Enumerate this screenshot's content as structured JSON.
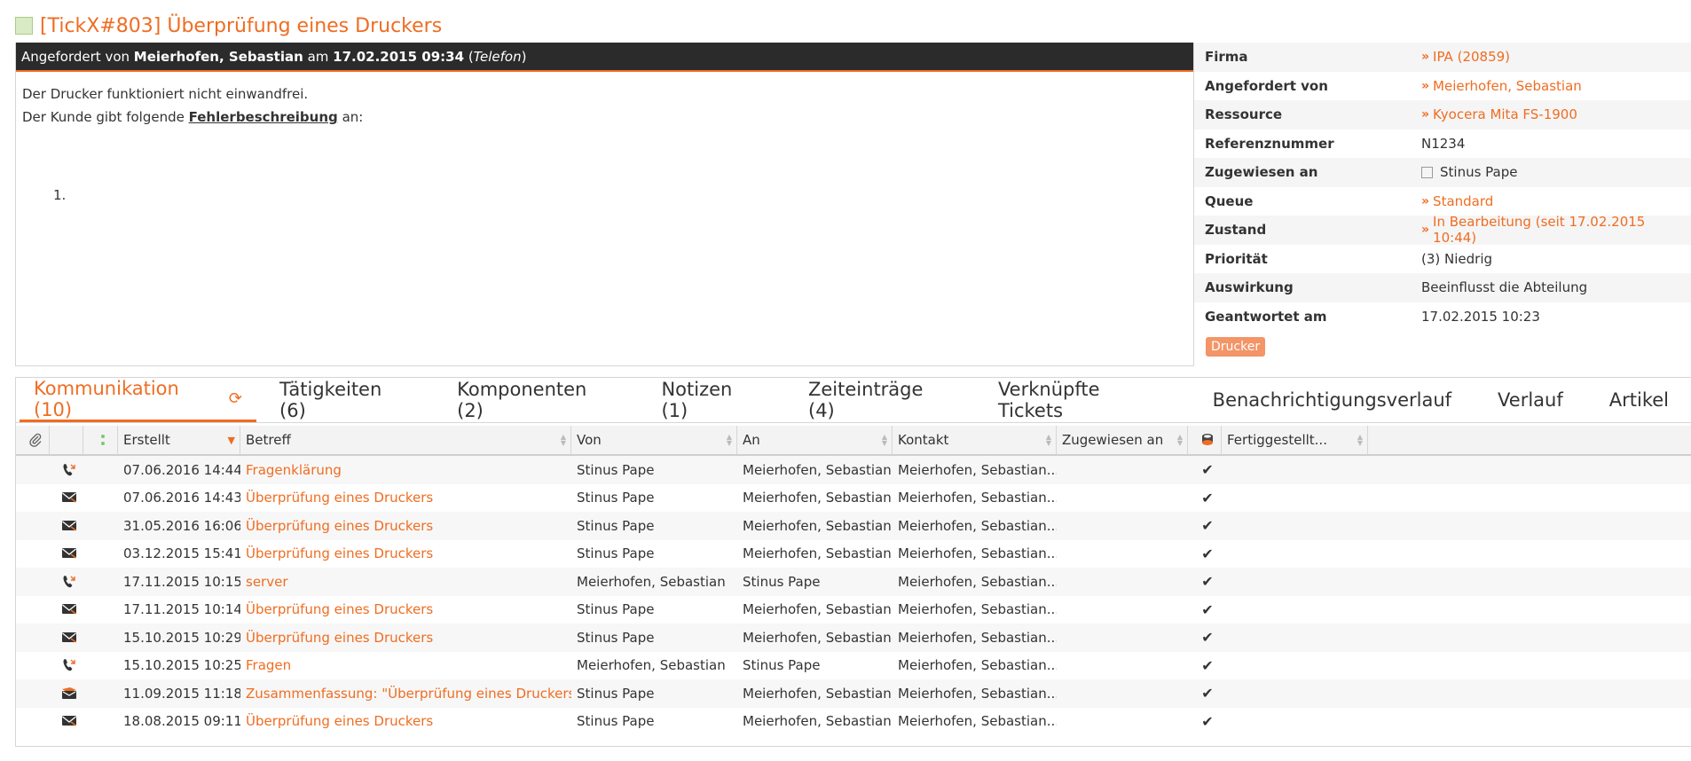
{
  "title": "[TickX#803] Überprüfung eines Druckers",
  "request": {
    "prefix": "Angefordert von",
    "requester": "Meierhofen, Sebastian",
    "at": "am",
    "datetime": "17.02.2015 09:34",
    "channel_open": "(",
    "channel": "Telefon",
    "channel_close": ")"
  },
  "description": {
    "line1": "Der Drucker funktioniert nicht einwandfrei.",
    "line2_prefix": "Der Kunde gibt folgende",
    "line2_link": "Fehlerbeschreibung",
    "line2_suffix": "an:",
    "list_item": "1."
  },
  "properties": [
    {
      "label": "Firma",
      "value": "IPA (20859)",
      "type": "link"
    },
    {
      "label": "Angefordert von",
      "value": "Meierhofen, Sebastian",
      "type": "link"
    },
    {
      "label": "Ressource",
      "value": "Kyocera Mita FS-1900",
      "type": "link"
    },
    {
      "label": "Referenznummer",
      "value": "N1234",
      "type": "text"
    },
    {
      "label": "Zugewiesen an",
      "value": "Stinus Pape",
      "type": "checkbox"
    },
    {
      "label": "Queue",
      "value": "Standard",
      "type": "link"
    },
    {
      "label": "Zustand",
      "value": "In Bearbeitung (seit 17.02.2015 10:44)",
      "type": "link"
    },
    {
      "label": "Priorität",
      "value": "(3) Niedrig",
      "type": "text"
    },
    {
      "label": "Auswirkung",
      "value": "Beeinflusst die Abteilung",
      "type": "text"
    },
    {
      "label": "Geantwortet am",
      "value": "17.02.2015 10:23",
      "type": "text"
    }
  ],
  "tag": "Drucker",
  "tabs": [
    {
      "label": "Kommunikation (10)",
      "active": true
    },
    {
      "label": "Tätigkeiten (6)"
    },
    {
      "label": "Komponenten (2)"
    },
    {
      "label": "Notizen (1)"
    },
    {
      "label": "Zeiteinträge (4)"
    },
    {
      "label": "Verknüpfte Tickets"
    },
    {
      "label": "Benachrichtigungsverlauf"
    },
    {
      "label": "Verlauf"
    },
    {
      "label": "Artikel"
    }
  ],
  "columns": {
    "created": "Erstellt",
    "subject": "Betreff",
    "from": "Von",
    "to": "An",
    "contact": "Kontakt",
    "assigned": "Zugewiesen an",
    "done": "Fertiggestellt..."
  },
  "rows": [
    {
      "type": "phone",
      "created": "07.06.2016 14:44",
      "subject": "Fragenklärung",
      "from": "Stinus Pape",
      "to": "Meierhofen, Sebastian",
      "contact": "Meierhofen, Sebastian...",
      "assigned": "",
      "done": "✔"
    },
    {
      "type": "mail",
      "created": "07.06.2016 14:43",
      "subject": "Überprüfung eines Druckers",
      "from": "Stinus Pape",
      "to": "Meierhofen, Sebastian",
      "contact": "Meierhofen, Sebastian...",
      "assigned": "",
      "done": "✔"
    },
    {
      "type": "mail",
      "created": "31.05.2016 16:06",
      "subject": "Überprüfung eines Druckers",
      "from": "Stinus Pape",
      "to": "Meierhofen, Sebastian",
      "contact": "Meierhofen, Sebastian...",
      "assigned": "",
      "done": "✔"
    },
    {
      "type": "mail",
      "created": "03.12.2015 15:41",
      "subject": "Überprüfung eines Druckers",
      "from": "Stinus Pape",
      "to": "Meierhofen, Sebastian",
      "contact": "Meierhofen, Sebastian...",
      "assigned": "",
      "done": "✔"
    },
    {
      "type": "phone-in",
      "created": "17.11.2015 10:15",
      "subject": "server",
      "from": "Meierhofen, Sebastian",
      "to": "Stinus Pape",
      "contact": "Meierhofen, Sebastian...",
      "assigned": "",
      "done": "✔"
    },
    {
      "type": "mail",
      "created": "17.11.2015 10:14",
      "subject": "Überprüfung eines Druckers",
      "from": "Stinus Pape",
      "to": "Meierhofen, Sebastian",
      "contact": "Meierhofen, Sebastian...",
      "assigned": "",
      "done": "✔"
    },
    {
      "type": "mail",
      "created": "15.10.2015 10:29",
      "subject": "Überprüfung eines Druckers",
      "from": "Stinus Pape",
      "to": "Meierhofen, Sebastian",
      "contact": "Meierhofen, Sebastian...",
      "assigned": "",
      "done": "✔"
    },
    {
      "type": "phone-in",
      "created": "15.10.2015 10:25",
      "subject": "Fragen",
      "from": "Meierhofen, Sebastian",
      "to": "Stinus Pape",
      "contact": "Meierhofen, Sebastian...",
      "assigned": "",
      "done": "✔"
    },
    {
      "type": "summary",
      "created": "11.09.2015 11:18",
      "subject": "Zusammenfassung: \"Überprüfung eines Druckers\"",
      "from": "Stinus Pape",
      "to": "Meierhofen, Sebastian",
      "contact": "Meierhofen, Sebastian...",
      "assigned": "",
      "done": "✔"
    },
    {
      "type": "mail",
      "created": "18.08.2015 09:11",
      "subject": "Überprüfung eines Druckers",
      "from": "Stinus Pape",
      "to": "Meierhofen, Sebastian",
      "contact": "Meierhofen, Sebastian...",
      "assigned": "",
      "done": "✔"
    }
  ],
  "colors": {
    "accent": "#ef6d22",
    "header_dark": "#2b2b2b",
    "status_green": "#7ec86f",
    "status_red": "#e06666"
  }
}
